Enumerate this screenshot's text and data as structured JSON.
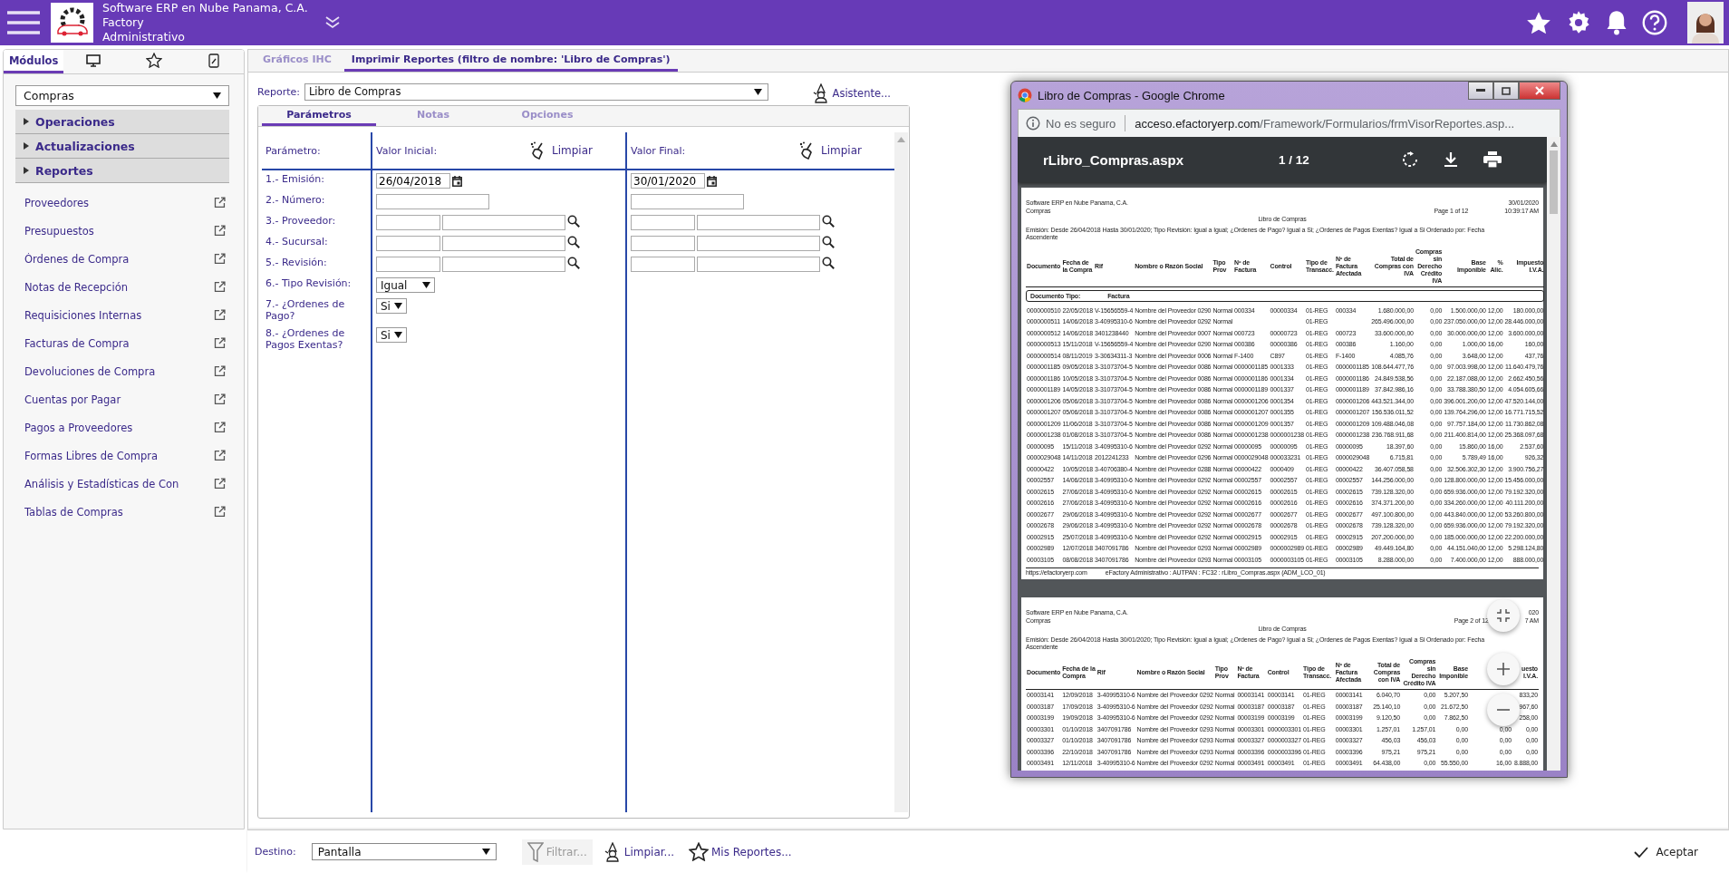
{
  "header": {
    "company": "Software ERP en Nube Panama, C.A.",
    "product": "Factory",
    "module": "Administrativo"
  },
  "sidebar": {
    "tabs": [
      {
        "kind": "text",
        "label": "Módulos",
        "selected": true
      },
      {
        "kind": "monitor",
        "selected": false
      },
      {
        "kind": "star",
        "selected": false
      },
      {
        "kind": "note",
        "selected": false
      }
    ],
    "module_select": {
      "value": "Compras"
    },
    "sections": [
      {
        "label": "Operaciones",
        "expanded": false
      },
      {
        "label": "Actualizaciones",
        "expanded": false
      },
      {
        "label": "Reportes",
        "expanded": false
      }
    ],
    "items": [
      "Proveedores",
      "Presupuestos",
      "Órdenes de Compra",
      "Notas de Recepción",
      "Requisiciones Internas",
      "Facturas de Compra",
      "Devoluciones de Compra",
      "Cuentas por Pagar",
      "Pagos a Proveedores",
      "Formas Libres de Compra",
      "Análisis y Estadísticas de Con",
      "Tablas de Compras"
    ]
  },
  "tabs": [
    {
      "label": "Gráficos IHC",
      "selected": false
    },
    {
      "label": "Imprimir Reportes (filtro de nombre: 'Libro de Compras')",
      "selected": true
    }
  ],
  "report_field": {
    "label": "Reporte:",
    "value": "Libro de Compras"
  },
  "wizard_button": "Asistente...",
  "param_tabs": [
    {
      "label": "Parámetros",
      "selected": true
    },
    {
      "label": "Notas",
      "selected": false
    },
    {
      "label": "Opciones",
      "selected": false
    }
  ],
  "params": {
    "header": {
      "parameter": "Parámetro:",
      "initial": "Valor Inicial:",
      "clear_initial": "Limpiar",
      "final": "Valor Final:",
      "clear_final": "Limpiar"
    },
    "rows": [
      {
        "label": "1.- Emisión:",
        "kind": "date",
        "initial": "26/04/2018",
        "final": "30/01/2020"
      },
      {
        "label": "2.- Número:",
        "kind": "text"
      },
      {
        "label": "3.- Proveedor:",
        "kind": "lookup"
      },
      {
        "label": "4.- Sucursal:",
        "kind": "lookup"
      },
      {
        "label": "5.- Revisión:",
        "kind": "lookup"
      },
      {
        "label": "6.- Tipo Revisión:",
        "kind": "select",
        "initial": "Igual"
      },
      {
        "label": "7.- ¿Ordenes de Pago?",
        "kind": "short-select",
        "initial": "Si"
      },
      {
        "label": "8.- ¿Ordenes de Pagos Exentas?",
        "kind": "short-select",
        "initial": "Si"
      }
    ]
  },
  "viewer": {
    "title": "Libro de Compras - Google Chrome",
    "security": "No es seguro",
    "url_host": "acceso.efactoryerp.com",
    "url_path": "/Framework/Formularios/frmVisorReportes.asp...",
    "file": "rLibro_Compras.aspx",
    "page_count": "1 / 12",
    "pages": [
      {
        "company": "Software ERP en Nube Panama, C.A.",
        "module": "Compras",
        "page": "Page 1 of 12",
        "date": "30/01/2020",
        "time": "10:39:17 AM",
        "title": "Libro de Compras",
        "filter": "Emisión: Desde 26/04/2018 Hasta 30/01/2020; Tipo Revisión: Igual a Igual; ¿Ordenes de Pago? Igual a Si; ¿Ordenes de Pagos Exentas? Igual a Si Ordenado por: Fecha Ascendente",
        "columns": [
          "Documento",
          "Fecha de la Compra",
          "Rif",
          "Nombre o Razón Social",
          "Tipo Prov",
          "Nº de Factura",
          "Control",
          "Tipo de Transacc.",
          "Nº de Factura Afectada",
          "Total de Compras con IVA",
          "Compras sin Derecho Crédito IVA",
          "Base Imponible",
          "% Alic.",
          "Impuesto I.V.A."
        ],
        "group": {
          "label": "Documento Tipo:",
          "value": "Factura"
        },
        "rows": [
          [
            "0000000510",
            "22/05/2018",
            "V-15656559-4",
            "Nombre del Proveedor 0290",
            "Normal",
            "000334",
            "00000334",
            "01-REG",
            "000334",
            "1.680.000,00",
            "0,00",
            "1.500.000,00",
            "12,00",
            "180.000,00"
          ],
          [
            "0000000511",
            "14/06/2018",
            "3-40995310-6",
            "Nombre del Proveedor 0292",
            "Normal",
            null,
            null,
            "01-REG",
            null,
            "265.496.000,00",
            "0,00",
            "237.050.000,00",
            "12,00",
            "28.446.000,00"
          ],
          [
            "0000000512",
            "14/06/2018",
            "3401238440",
            "Nombre del Proveedor 0007",
            "Normal",
            "000723",
            "00000723",
            "01-REG",
            "000723",
            "33.600.000,00",
            "0,00",
            "30.000.000,00",
            "12,00",
            "3.600.000,00"
          ],
          [
            "0000000513",
            "15/11/2018",
            "V-15656559-4",
            "Nombre del Proveedor 0290",
            "Normal",
            "000386",
            "00000386",
            "01-REG",
            "000386",
            "1.160,00",
            "0,00",
            "1.000,00",
            "16,00",
            "160,00"
          ],
          [
            "0000000514",
            "08/11/2019",
            "3-30634311-3",
            "Nombre del Proveedor 0006",
            "Normal",
            "F-1400",
            "C897",
            "01-REG",
            "F-1400",
            "4.085,76",
            "0,00",
            "3.648,00",
            "12,00",
            "437,76"
          ],
          [
            "0000001185",
            "09/05/2018",
            "3-31073704-5",
            "Nombre del Proveedor 0086",
            "Normal",
            "0000001185",
            "0001333",
            "01-REG",
            "0000001185",
            "108.644.477,76",
            "0,00",
            "97.003.998,00",
            "12,00",
            "11.640.479,76"
          ],
          [
            "0000001186",
            "10/05/2018",
            "3-31073704-5",
            "Nombre del Proveedor 0086",
            "Normal",
            "0000001186",
            "0001334",
            "01-REG",
            "0000001186",
            "24.849.538,56",
            "0,00",
            "22.187.088,00",
            "12,00",
            "2.662.450,56"
          ],
          [
            "0000001189",
            "14/05/2018",
            "3-31073704-5",
            "Nombre del Proveedor 0086",
            "Normal",
            "0000001189",
            "0001337",
            "01-REG",
            "0000001189",
            "37.842.986,16",
            "0,00",
            "33.788.380,50",
            "12,00",
            "4.054.605,66"
          ],
          [
            "0000001206",
            "05/06/2018",
            "3-31073704-5",
            "Nombre del Proveedor 0086",
            "Normal",
            "0000001206",
            "0001354",
            "01-REG",
            "0000001206",
            "443.521.344,00",
            "0,00",
            "396.001.200,00",
            "12,00",
            "47.520.144,00"
          ],
          [
            "0000001207",
            "05/06/2018",
            "3-31073704-5",
            "Nombre del Proveedor 0086",
            "Normal",
            "0000001207",
            "0001355",
            "01-REG",
            "0000001207",
            "156.536.011,52",
            "0,00",
            "139.764.296,00",
            "12,00",
            "16.771.715,52"
          ],
          [
            "0000001209",
            "11/06/2018",
            "3-31073704-5",
            "Nombre del Proveedor 0086",
            "Normal",
            "0000001209",
            "0001357",
            "01-REG",
            "0000001209",
            "109.488.046,08",
            "0,00",
            "97.757.184,00",
            "12,00",
            "11.730.862,08"
          ],
          [
            "0000001238",
            "01/08/2018",
            "3-31073704-5",
            "Nombre del Proveedor 0086",
            "Normal",
            "0000001238",
            "0000001238",
            "01-REG",
            "0000001238",
            "236.768.911,68",
            "0,00",
            "211.400.814,00",
            "12,00",
            "25.368.097,68"
          ],
          [
            "00000095",
            "15/11/2018",
            "3-40995310-6",
            "Nombre del Proveedor 0292",
            "Normal",
            "00000095",
            "00000095",
            "01-REG",
            "00000095",
            "18.397,60",
            "0,00",
            "15.860,00",
            "16,00",
            "2.537,60"
          ],
          [
            "0000029048",
            "14/11/2018",
            "2012241233",
            "Nombre del Proveedor 0296",
            "Normal",
            "0000029048",
            "000033231",
            "01-REG",
            "0000029048",
            "6.715,81",
            "0,00",
            "5.789,49",
            "16,00",
            "926,32"
          ],
          [
            "00000422",
            "10/05/2018",
            "3-40706380-4",
            "Nombre del Proveedor 0288",
            "Normal",
            "00000422",
            "0000409",
            "01-REG",
            "00000422",
            "36.407.058,58",
            "0,00",
            "32.506.302,30",
            "12,00",
            "3.900.756,27"
          ],
          [
            "00002557",
            "14/06/2018",
            "3-40995310-6",
            "Nombre del Proveedor 0292",
            "Normal",
            "00002557",
            "00002557",
            "01-REG",
            "00002557",
            "144.256.000,00",
            "0,00",
            "128.800.000,00",
            "12,00",
            "15.456.000,00"
          ],
          [
            "00002615",
            "27/06/2018",
            "3-40995310-6",
            "Nombre del Proveedor 0292",
            "Normal",
            "00002615",
            "00002615",
            "01-REG",
            "00002615",
            "739.128.320,00",
            "0,00",
            "659.936.000,00",
            "12,00",
            "79.192.320,00"
          ],
          [
            "00002616",
            "27/06/2018",
            "3-40995310-6",
            "Nombre del Proveedor 0292",
            "Normal",
            "00002616",
            "00002616",
            "01-REG",
            "00002616",
            "374.371.200,00",
            "0,00",
            "334.260.000,00",
            "12,00",
            "40.111.200,00"
          ],
          [
            "00002677",
            "29/06/2018",
            "3-40995310-6",
            "Nombre del Proveedor 0292",
            "Normal",
            "00002677",
            "00002677",
            "01-REG",
            "00002677",
            "497.100.800,00",
            "0,00",
            "443.840.000,00",
            "12,00",
            "53.260.800,00"
          ],
          [
            "00002678",
            "29/06/2018",
            "3-40995310-6",
            "Nombre del Proveedor 0292",
            "Normal",
            "00002678",
            "00002678",
            "01-REG",
            "00002678",
            "739.128.320,00",
            "0,00",
            "659.936.000,00",
            "12,00",
            "79.192.320,00"
          ],
          [
            "00002915",
            "25/07/2018",
            "3-40995310-6",
            "Nombre del Proveedor 0292",
            "Normal",
            "00002915",
            "00002915",
            "01-REG",
            "00002915",
            "207.200.000,00",
            "0,00",
            "185.000.000,00",
            "12,00",
            "22.200.000,00"
          ],
          [
            "00002989",
            "12/07/2018",
            "3407091786",
            "Nombre del Proveedor 0293",
            "Normal",
            "00002989",
            "0000002989",
            "01-REG",
            "00002989",
            "49.449.164,80",
            "0,00",
            "44.151.040,00",
            "12,00",
            "5.298.124,80"
          ],
          [
            "00003105",
            "08/08/2018",
            "3407091786",
            "Nombre del Proveedor 0293",
            "Normal",
            "00003105",
            "0000003105",
            "01-REG",
            "00003105",
            "8.288.000,00",
            "0,00",
            "7.400.000,00",
            "12,00",
            "888.000,00"
          ]
        ],
        "footer_url": "https://efactoryerp.com",
        "footer_info": "eFactory Administrativo : AUTPAN : FC32 : rLibro_Compras.aspx (ADM_LCO_01)"
      },
      {
        "company": "Software ERP en Nube Panama, C.A.",
        "module": "Compras",
        "page": "Page 2 of 12",
        "date": "020",
        "time": "7 AM",
        "title": "Libro de Compras",
        "filter": "Emisión: Desde 26/04/2018 Hasta 30/01/2020; Tipo Revisión: Igual a Igual; ¿Ordenes de Pago? Igual a Si; ¿Ordenes de Pagos Exentas? Igual a Si Ordenado por: Fecha Ascendente",
        "columns": [
          "Documento",
          "Fecha de la Compra",
          "Rif",
          "Nombre o Razón Social",
          "Tipo Prov",
          "Nº de Factura",
          "Control",
          "Tipo de Transacc.",
          "Nº de Factura Afectada",
          "Total de Compras con IVA",
          "Compras sin Derecho Crédito IVA",
          "Base Imponible",
          null,
          "uesto I.V.A."
        ],
        "rows": [
          [
            "00003141",
            "12/09/2018",
            "3-40995310-6",
            "Nombre del Proveedor 0292",
            "Normal",
            "00003141",
            "00003141",
            "01-REG",
            "00003141",
            "6.040,70",
            "0,00",
            "5.207,50",
            null,
            "833,20"
          ],
          [
            "00003187",
            "17/09/2018",
            "3-40995310-6",
            "Nombre del Proveedor 0292",
            "Normal",
            "00003187",
            "00003187",
            "01-REG",
            "00003187",
            "25.140,10",
            "0,00",
            "21.672,50",
            null,
            "967,60"
          ],
          [
            "00003199",
            "19/09/2018",
            "3-40995310-6",
            "Nombre del Proveedor 0292",
            "Normal",
            "00003199",
            "00003199",
            "01-REG",
            "00003199",
            "9.120,50",
            "0,00",
            "7.862,50",
            null,
            "258,00"
          ],
          [
            "00003301",
            "01/10/2018",
            "3407091786",
            "Nombre del Proveedor 0293",
            "Normal",
            "00003301",
            "0000003301",
            "01-REG",
            "00003301",
            "1.257,01",
            "1.257,01",
            "0,00",
            "0,00",
            "0,00"
          ],
          [
            "00003327",
            "01/10/2018",
            "3407091786",
            "Nombre del Proveedor 0293",
            "Normal",
            "00003327",
            "0000003327",
            "01-REG",
            "00003327",
            "456,03",
            "456,03",
            "0,00",
            "0,00",
            "0,00"
          ],
          [
            "00003396",
            "22/10/2018",
            "3407091786",
            "Nombre del Proveedor 0293",
            "Normal",
            "00003396",
            "0000003396",
            "01-REG",
            "00003396",
            "975,21",
            "975,21",
            "0,00",
            "0,00",
            "0,00"
          ],
          [
            "00003491",
            "12/11/2018",
            "3-40995310-6",
            "Nombre del Proveedor 0292",
            "Normal",
            "00003491",
            "00003491",
            "01-REG",
            "00003491",
            "64.438,00",
            "0,00",
            "55.550,00",
            "16,00",
            "8.888,00"
          ]
        ]
      }
    ]
  },
  "footer": {
    "destination_label": "Destino:",
    "destination": "Pantalla",
    "filter": "Filtrar...",
    "filter_disabled": true,
    "clear": "Limpiar...",
    "my_reports": "Mis Reportes...",
    "accept": "Aceptar"
  }
}
